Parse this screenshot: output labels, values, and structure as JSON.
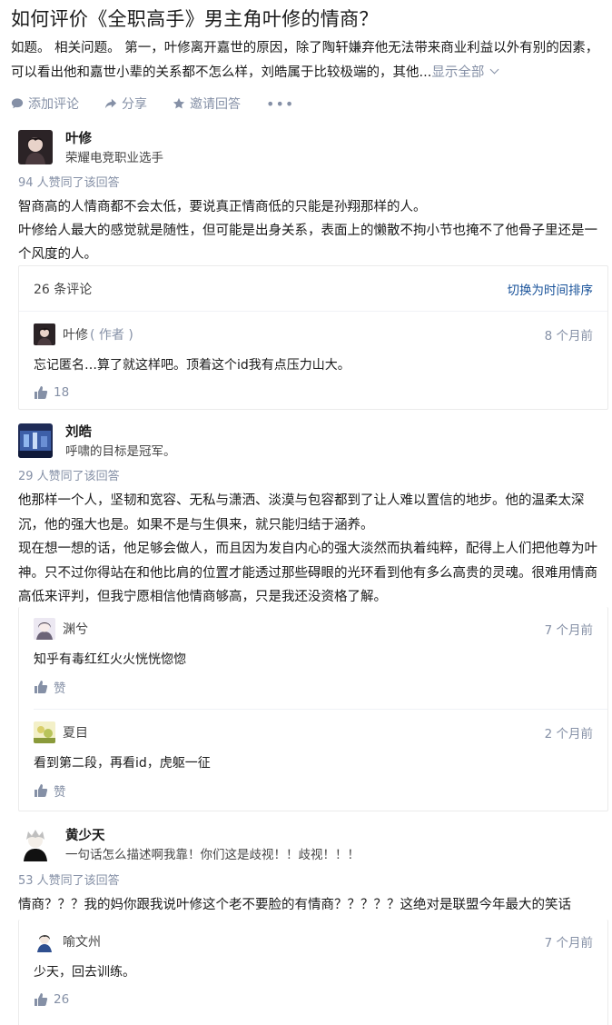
{
  "question": {
    "title": "如何评价《全职高手》男主角叶修的情商？",
    "detail": "如题。 相关问题。 第一，叶修离开嘉世的原因，除了陶轩嫌弃他无法带来商业利益以外有别的因素，可以看出他和嘉世小辈的关系都不怎么样，刘皓属于比较极端的，其他...",
    "show_all": "显示全部"
  },
  "actions": {
    "comment": "添加评论",
    "share": "分享",
    "invite": "邀请回答",
    "more": "•••"
  },
  "answers": [
    {
      "author": "叶修",
      "bio": "荣耀电竞职业选手",
      "votes": "94 人赞同了该回答",
      "paragraphs": [
        "智商高的人情商都不会太低，要说真正情商低的只能是孙翔那样的人。",
        "叶修给人最大的感觉就是随性，但可能是出身关系，表面上的懒散不拘小节也掩不了他骨子里还是一个风度的人。"
      ],
      "comments_count": "26 条评论",
      "sort_label": "切换为时间排序",
      "comments": [
        {
          "name": "叶修",
          "tag": "( 作者 )",
          "time": "8 个月前",
          "text": "忘记匿名…算了就这样吧。顶着这个id我有点压力山大。",
          "likes": "18"
        }
      ]
    },
    {
      "author": "刘皓",
      "bio": "呼啸的目标是冠军。",
      "votes": "29 人赞同了该回答",
      "paragraphs": [
        "他那样一个人，坚韧和宽容、无私与潇洒、淡漠与包容都到了让人难以置信的地步。他的温柔太深沉，他的强大也是。如果不是与生俱来，就只能归结于涵养。",
        "现在想一想的话，他足够会做人，而且因为发自内心的强大淡然而执着纯粹，配得上人们把他尊为叶神。只不过你得站在和他比肩的位置才能透过那些碍眼的光环看到他有多么高贵的灵魂。很难用情商高低来评判，但我宁愿相信他情商够高，只是我还没资格了解。"
      ],
      "comments": [
        {
          "name": "渊兮",
          "time": "7 个月前",
          "text": "知乎有毒红红火火恍恍惚惚",
          "likes": "赞"
        },
        {
          "name": "夏目",
          "time": "2 个月前",
          "text": "看到第二段，再看id，虎躯一征",
          "likes": "赞"
        }
      ]
    },
    {
      "author": "黄少天",
      "bio": "一句话怎么描述啊我靠！你们这是歧视！！歧视！！！",
      "votes": "53 人赞同了该回答",
      "paragraphs": [
        "情商？？？我的妈你跟我说叶修这个老不要脸的有情商？？？？？这绝对是联盟今年最大的笑话"
      ],
      "comments": [
        {
          "name": "喻文州",
          "time": "7 个月前",
          "text": "少天，回去训练。",
          "likes": "26"
        }
      ]
    }
  ]
}
